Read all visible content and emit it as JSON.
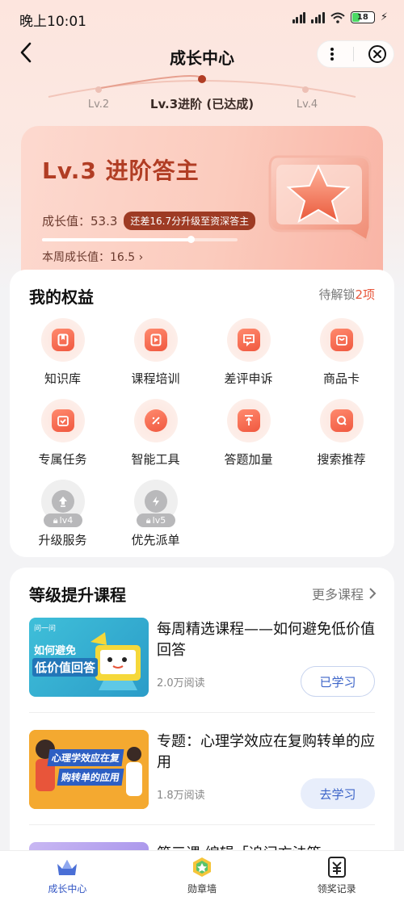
{
  "status_bar": {
    "time": "晚上10:01",
    "battery": "18"
  },
  "nav": {
    "title": "成长中心"
  },
  "level_track": {
    "prev": "Lv.2",
    "current": "Lv.3进阶 (已达成)",
    "next": "Lv.4"
  },
  "level_card": {
    "name": "Lv.3  进阶答主",
    "growth": "成长值：53.3",
    "hint": "还差16.7分升级至资深答主",
    "progress": 0.76,
    "weekly": "本周成长值：16.5  ›"
  },
  "rights": {
    "title": "我的权益",
    "pending_prefix": "待解锁",
    "pending_count": "2项",
    "items": [
      {
        "label": "知识库",
        "icon": "bookmark-icon",
        "locked": false
      },
      {
        "label": "课程培训",
        "icon": "play-icon",
        "locked": false
      },
      {
        "label": "差评申诉",
        "icon": "chat-icon",
        "locked": false
      },
      {
        "label": "商品卡",
        "icon": "bag-icon",
        "locked": false
      },
      {
        "label": "专属任务",
        "icon": "task-check-icon",
        "locked": false
      },
      {
        "label": "智能工具",
        "icon": "magic-wand-icon",
        "locked": false
      },
      {
        "label": "答题加量",
        "icon": "upload-icon",
        "locked": false
      },
      {
        "label": "搜索推荐",
        "icon": "search-icon",
        "locked": false
      },
      {
        "label": "升级服务",
        "icon": "upgrade-arrow-icon",
        "locked": true,
        "lock_level": "lv4"
      },
      {
        "label": "优先派单",
        "icon": "lightning-icon",
        "locked": true,
        "lock_level": "lv5"
      }
    ]
  },
  "courses": {
    "title": "等级提升课程",
    "more": "更多课程",
    "items": [
      {
        "title": "每周精选课程——如何避免低价值回答",
        "reads": "2.0万阅读",
        "action": "已学习",
        "thumb_brand": "问一问",
        "thumb_text1": "如何避免",
        "thumb_text2": "低价值回答"
      },
      {
        "title": "专题：心理学效应在复购转单的应用",
        "reads": "1.8万阅读",
        "action": "去学习",
        "thumb_text1": "心理学效应在复",
        "thumb_text2": "购转单的应用"
      }
    ],
    "partial_title": "第三课 编辑「追问方法篇"
  },
  "tabbar": {
    "items": [
      {
        "label": "成长中心",
        "icon": "crown-icon",
        "active": true
      },
      {
        "label": "勋章墙",
        "icon": "medal-icon",
        "active": false
      },
      {
        "label": "领奖记录",
        "icon": "yuan-receipt-icon",
        "active": false
      }
    ]
  },
  "colors": {
    "accent": "#e8553a",
    "brand_blue": "#3c64c8",
    "card_red": "#b13d24"
  }
}
